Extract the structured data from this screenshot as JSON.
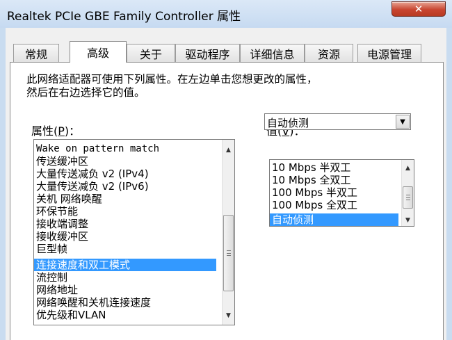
{
  "window": {
    "title": "Realtek PCIe GBE Family Controller 属性",
    "close_glyph": "✕"
  },
  "tabs": [
    {
      "label": "常规"
    },
    {
      "label": "高级"
    },
    {
      "label": "关于"
    },
    {
      "label": "驱动程序"
    },
    {
      "label": "详细信息"
    },
    {
      "label": "资源"
    },
    {
      "label": "电源管理"
    }
  ],
  "active_tab": "高级",
  "description": {
    "line1": "此网络适配器可使用下列属性。在左边单击您想更改的属性，",
    "line2": "然后在右边选择它的值。"
  },
  "property": {
    "label": "属性",
    "mnemonic": "P",
    "items": [
      "Wake on pattern match",
      "传送缓冲区",
      "大量传送减负 v2 (IPv4)",
      "大量传送减负 v2 (IPv6)",
      "关机 网络唤醒",
      "环保节能",
      "接收端调整",
      "接收缓冲区",
      "巨型帧",
      "连接速度和双工模式",
      "流控制",
      "网络地址",
      "网络唤醒和关机连接速度",
      "优先级和VLAN"
    ],
    "selected": "连接速度和双工模式"
  },
  "value": {
    "label": "值",
    "mnemonic": "V",
    "current": "自动侦测",
    "options": [
      "10 Mbps 半双工",
      "10 Mbps 全双工",
      "100 Mbps 半双工",
      "100 Mbps 全双工",
      "自动侦测"
    ],
    "selected": "自动侦测"
  },
  "icons": {
    "scroll_up": "▲",
    "scroll_down": "▼",
    "dropdown": "▼"
  }
}
